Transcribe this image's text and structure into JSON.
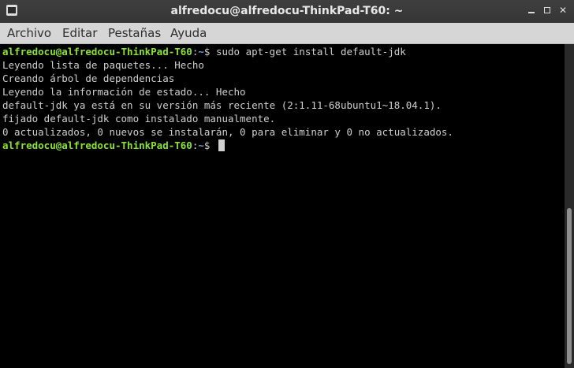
{
  "window": {
    "title": "alfredocu@alfredocu-ThinkPad-T60: ~",
    "controls": {
      "minimize": "",
      "maximize": "",
      "close": "✕"
    }
  },
  "menu": [
    "Archivo",
    "Editar",
    "Pestañas",
    "Ayuda"
  ],
  "terminal": {
    "prompt_user": "alfredocu@alfredocu-ThinkPad-T60",
    "prompt_sep": ":",
    "prompt_path": "~",
    "prompt_symbol": "$ ",
    "command": "sudo apt-get install default-jdk",
    "output": [
      "Leyendo lista de paquetes... Hecho",
      "Creando árbol de dependencias",
      "Leyendo la información de estado... Hecho",
      "default-jdk ya está en su versión más reciente (2:1.11-68ubuntu1~18.04.1).",
      "fijado default-jdk como instalado manualmente.",
      "0 actualizados, 0 nuevos se instalarán, 0 para eliminar y 0 no actualizados."
    ]
  },
  "colors": {
    "prompt_user": "#8ae234",
    "prompt_path": "#729fcf",
    "text": "#cfcfcf",
    "background": "#000000"
  }
}
